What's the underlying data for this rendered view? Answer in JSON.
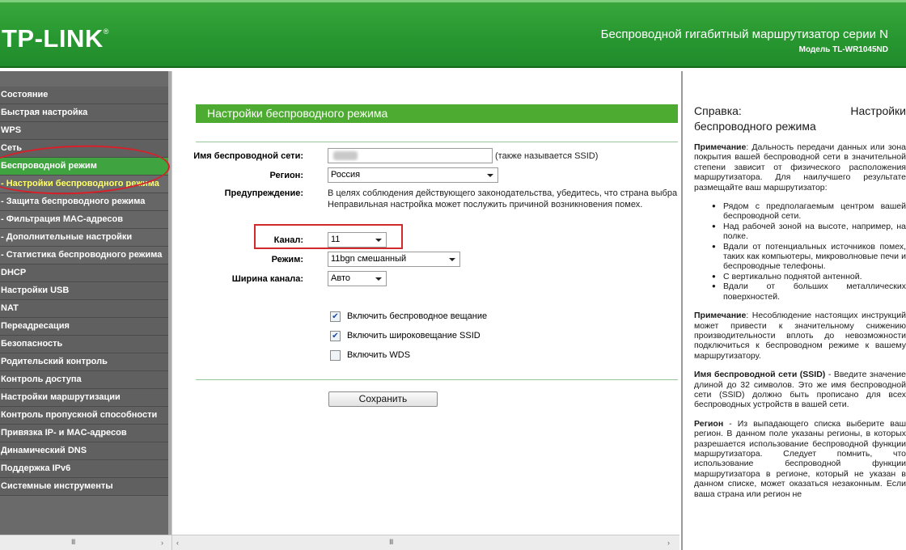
{
  "header": {
    "logo": "TP-LINK",
    "logo_mark": "®",
    "product": "Беспроводной гигабитный маршрутизатор серии N",
    "model": "Модель TL-WR1045ND"
  },
  "sidebar": {
    "items": [
      {
        "label": "Состояние"
      },
      {
        "label": "Быстрая настройка"
      },
      {
        "label": "WPS"
      },
      {
        "label": "Сеть"
      },
      {
        "label": "Беспроводной режим"
      },
      {
        "label": "- Настройки беспроводного режима"
      },
      {
        "label": "- Защита беспроводного режима"
      },
      {
        "label": "- Фильтрация MAC-адресов"
      },
      {
        "label": "- Дополнительные настройки"
      },
      {
        "label": "- Статистика беспроводного режима"
      },
      {
        "label": "DHCP"
      },
      {
        "label": "Настройки USB"
      },
      {
        "label": "NAT"
      },
      {
        "label": "Переадресация"
      },
      {
        "label": "Безопасность"
      },
      {
        "label": "Родительский контроль"
      },
      {
        "label": "Контроль доступа"
      },
      {
        "label": "Настройки маршрутизации"
      },
      {
        "label": "Контроль пропускной способности"
      },
      {
        "label": "Привязка IP- и MAC-адресов"
      },
      {
        "label": "Динамический DNS"
      },
      {
        "label": "Поддержка IPv6"
      },
      {
        "label": "Системные инструменты"
      }
    ]
  },
  "main": {
    "title": "Настройки беспроводного режима",
    "ssid_label": "Имя беспроводной сети:",
    "ssid_note": "(также называется SSID)",
    "region_label": "Регион:",
    "region_value": "Россия",
    "warning_label": "Предупреждение:",
    "warning_line1": "В целях соблюдения действующего законодательства, убедитесь, что страна выбра",
    "warning_line2": "Неправильная настройка может послужить причиной возникновения помех.",
    "channel_label": "Канал:",
    "channel_value": "11",
    "mode_label": "Режим:",
    "mode_value": "11bgn смешанный",
    "width_label": "Ширина канала:",
    "width_value": "Авто",
    "checkboxes": [
      {
        "label": "Включить беспроводное вещание",
        "checked": true
      },
      {
        "label": "Включить широковещание SSID",
        "checked": true
      },
      {
        "label": "Включить WDS",
        "checked": false
      }
    ],
    "save_label": "Сохранить"
  },
  "help": {
    "title_left": "Справка:",
    "title_right": "Настройки",
    "title_line2": "беспроводного режима",
    "note1_bold": "Примечание",
    "note1_text": ": Дальность передачи данных или зона покрытия вашей беспроводной сети в значительной степени зависит от физического расположения маршрутизатора. Для наилучшего результате размещайте ваш маршрутизатор:",
    "bullets": [
      "Рядом с предполагаемым центром вашей беспроводной сети.",
      "Над рабочей зоной на высоте, например, на полке.",
      "Вдали от потенциальных источников помех, таких как компьютеры, микроволновые печи и беспроводные телефоны.",
      "С вертикально поднятой антенной.",
      "Вдали от больших металлических поверхностей."
    ],
    "note2_bold": "Примечание",
    "note2_text": ": Несоблюдение настоящих инструкций может привести к значительному снижению производительности вплоть до невозможности подключиться к беспроводном режиме к вашему маршрутизатору.",
    "ssid_bold": "Имя беспроводной сети (SSID)",
    "ssid_text": " - Введите значение длиной до 32 символов. Это же имя беспроводной сети (SSID) должно быть прописано для всех беспроводных устройств в вашей сети.",
    "region_bold": "Регион",
    "region_text": " - Из выпадающего списка выберите ваш регион. В данном поле указаны регионы, в которых разрешается использование беспроводной функции маршрутизатора. Следует помнить, что использование беспроводной функции маршрутизатора в регионе, который не указан в данном списке, может оказаться незаконным. Если ваша страна или регион не"
  },
  "scrollbar": {
    "grip": "III",
    "left": "‹",
    "right": "›"
  }
}
